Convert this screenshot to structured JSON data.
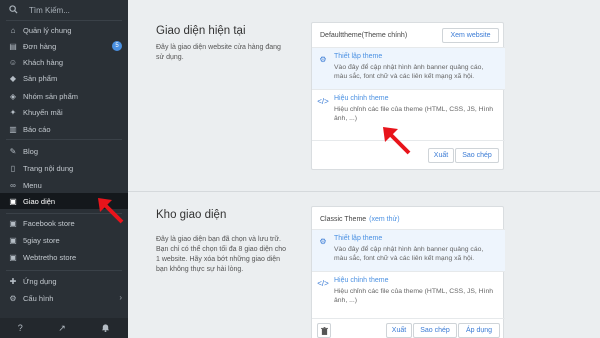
{
  "sidebar": {
    "search_placeholder": "Tìm Kiếm...",
    "items": [
      {
        "label": "Quản lý chung",
        "icon": "dashboard-icon"
      },
      {
        "label": "Đơn hàng",
        "icon": "orders-icon",
        "badge": "5"
      },
      {
        "label": "Khách hàng",
        "icon": "customers-icon"
      },
      {
        "label": "Sản phẩm",
        "icon": "products-icon"
      },
      {
        "label": "Nhóm sản phẩm",
        "icon": "product-groups-icon"
      },
      {
        "label": "Khuyến mãi",
        "icon": "promotion-icon"
      },
      {
        "label": "Báo cáo",
        "icon": "report-icon"
      },
      {
        "label": "Blog",
        "icon": "blog-icon"
      },
      {
        "label": "Trang nội dung",
        "icon": "content-page-icon"
      },
      {
        "label": "Menu",
        "icon": "menu-link-icon"
      },
      {
        "label": "Giao diện",
        "icon": "theme-icon",
        "active": true
      },
      {
        "label": "Facebook store",
        "icon": "facebook-icon"
      },
      {
        "label": "5giay store",
        "icon": "store-icon"
      },
      {
        "label": "Webtretho store",
        "icon": "store-icon"
      },
      {
        "label": "Ứng dụng",
        "icon": "apps-icon"
      },
      {
        "label": "Cấu hình",
        "icon": "settings-icon"
      }
    ]
  },
  "current_theme": {
    "title": "Giao diện hiện tại",
    "description": "Đây là giao diện website cửa hàng đang sử dụng.",
    "card_name": "Defaulttheme(Theme chính)",
    "view_website": "Xem website",
    "setup_title": "Thiết lập theme",
    "setup_desc": "Vào đây để cập nhật hình ảnh banner quảng cáo, màu sắc, font chữ và các liên kết mạng xã hội.",
    "edit_title": "Hiệu chỉnh theme",
    "edit_desc": "Hiệu chỉnh các file của theme (HTML, CSS, JS, Hình ảnh, ...)",
    "export": "Xuất",
    "copy": "Sao chép"
  },
  "theme_store": {
    "title": "Kho giao diện",
    "description": "Đây là giao diện bạn đã chọn và lưu trữ. Bạn chỉ có thể chọn tối đa 8 giao diện cho 1 website. Hãy xóa bớt những giao diện bạn không thực sự hài lòng.",
    "card_name": "Classic Theme",
    "card_link": "(xem thử)",
    "setup_title": "Thiết lập theme",
    "setup_desc": "Vào đây để cập nhật hình ảnh banner quảng cáo, màu sắc, font chữ và các liên kết mạng xã hội.",
    "edit_title": "Hiệu chỉnh theme",
    "edit_desc": "Hiệu chỉnh các file của theme (HTML, CSS, JS, Hình ảnh, ...)",
    "export": "Xuất",
    "copy": "Sao chép",
    "apply": "Áp dụng"
  },
  "colors": {
    "sidebar": "#2a3036",
    "accent": "#4a90e2",
    "arrow": "#e8141b"
  }
}
